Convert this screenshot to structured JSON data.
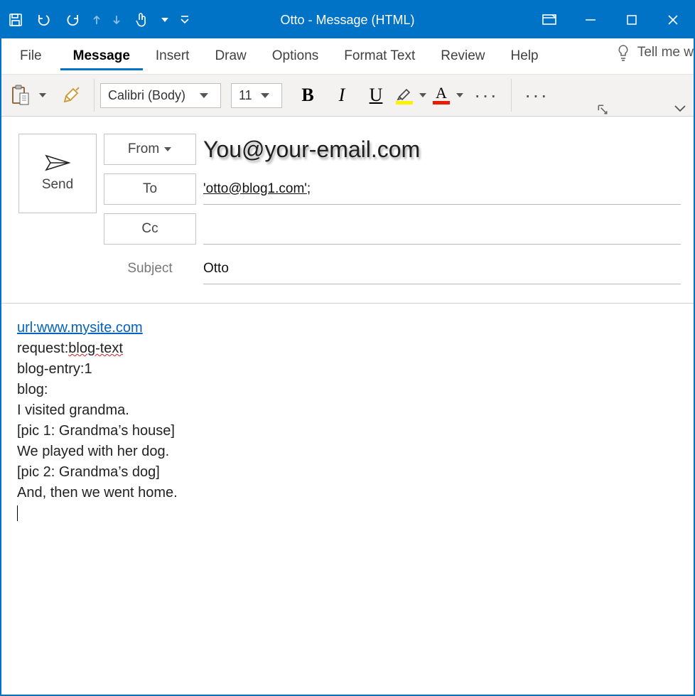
{
  "title": "Otto  -  Message (HTML)",
  "tabs": {
    "file": "File",
    "message": "Message",
    "insert": "Insert",
    "draw": "Draw",
    "options": "Options",
    "format": "Format Text",
    "review": "Review",
    "help": "Help",
    "tell": "Tell me w"
  },
  "ribbon": {
    "font_name": "Calibri (Body)",
    "font_size": "11",
    "bold": "B",
    "italic": "I",
    "underline": "U",
    "hl_letter": "A",
    "fc_letter": "A",
    "hl_color": "#FFF200",
    "fc_color": "#E81D04"
  },
  "header": {
    "send": "Send",
    "from_label": "From",
    "from_value": "You@your-email.com",
    "to_label": "To",
    "to_value": "'otto@blog1.com'",
    "to_suffix": ";",
    "cc_label": "Cc",
    "subject_label": "Subject",
    "subject_value": "Otto"
  },
  "body": {
    "link": "url:www.mysite.com",
    "l2a": "request:",
    "l2b": "blog-text",
    "l3": "blog-entry:1",
    "l4": "blog:",
    "l5": "I visited grandma.",
    "l6": "[pic 1: Grandma’s house]",
    "l7": "We played with her dog.",
    "l8": "[pic 2: Grandma’s dog]",
    "l9": "And, then we went home."
  }
}
